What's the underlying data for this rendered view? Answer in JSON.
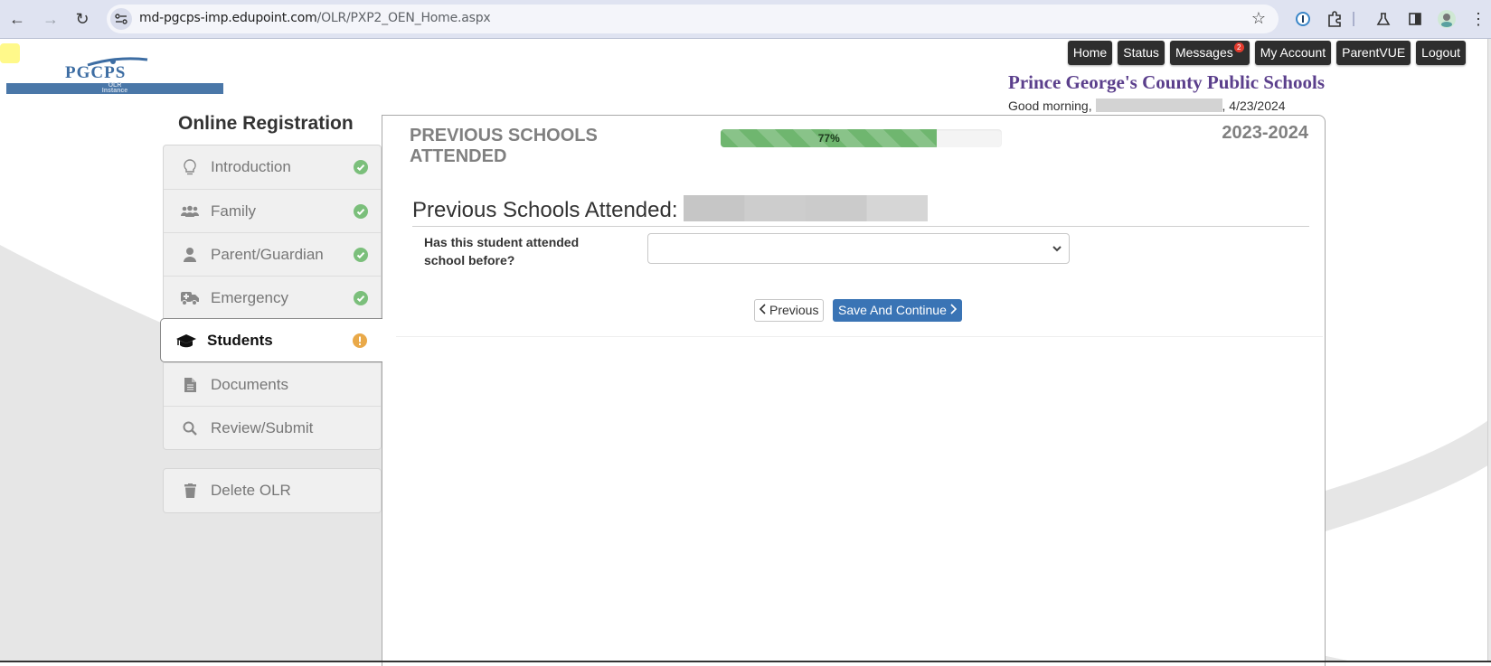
{
  "browser": {
    "url_domain": "md-pgcps-imp.edupoint.com",
    "url_path": "/OLR/PXP2_OEN_Home.aspx",
    "icons": [
      "back-icon",
      "forward-icon",
      "reload-icon",
      "site-info-icon",
      "bookmark-star-icon",
      "password-manager-icon",
      "extensions-icon",
      "labs-icon",
      "side-panel-icon",
      "profile-avatar",
      "menu-icon"
    ]
  },
  "header": {
    "logo_text": "PGCPS",
    "logo_band_line1": "OLR",
    "logo_band_line2": "Instance",
    "district_name": "Prince George's County Public Schools",
    "greeting_prefix": "Good morning,",
    "greeting_date": ", 4/23/2024",
    "nav": [
      {
        "label": "Home"
      },
      {
        "label": "Status"
      },
      {
        "label": "Messages",
        "badge": "2"
      },
      {
        "label": "My Account"
      },
      {
        "label": "ParentVUE"
      },
      {
        "label": "Logout"
      }
    ]
  },
  "sidebar": {
    "title": "Online Registration",
    "items": [
      {
        "label": "Introduction",
        "icon": "lightbulb-icon",
        "status": "complete"
      },
      {
        "label": "Family",
        "icon": "users-icon",
        "status": "complete"
      },
      {
        "label": "Parent/Guardian",
        "icon": "user-icon",
        "status": "complete"
      },
      {
        "label": "Emergency",
        "icon": "ambulance-icon",
        "status": "complete"
      },
      {
        "label": "Students",
        "icon": "graduation-cap-icon",
        "status": "warning",
        "active": true
      },
      {
        "label": "Documents",
        "icon": "document-icon",
        "status": ""
      },
      {
        "label": "Review/Submit",
        "icon": "search-icon",
        "status": ""
      }
    ],
    "delete_label": "Delete OLR"
  },
  "main": {
    "section_title": "PREVIOUS SCHOOLS ATTENDED",
    "progress_percent": 77,
    "progress_label": "77%",
    "school_year": "2023-2024",
    "subheading": "Previous Schools Attended:",
    "question_label": "Has this student attended school before?",
    "question_value": "",
    "prev_button": "Previous",
    "save_button": "Save And Continue"
  },
  "colors": {
    "district_purple": "#5b3f8c",
    "progress_green": "#6fb66f",
    "complete_green": "#7bbf7b",
    "warning_orange": "#e9a949",
    "primary_blue": "#3a74b5"
  }
}
